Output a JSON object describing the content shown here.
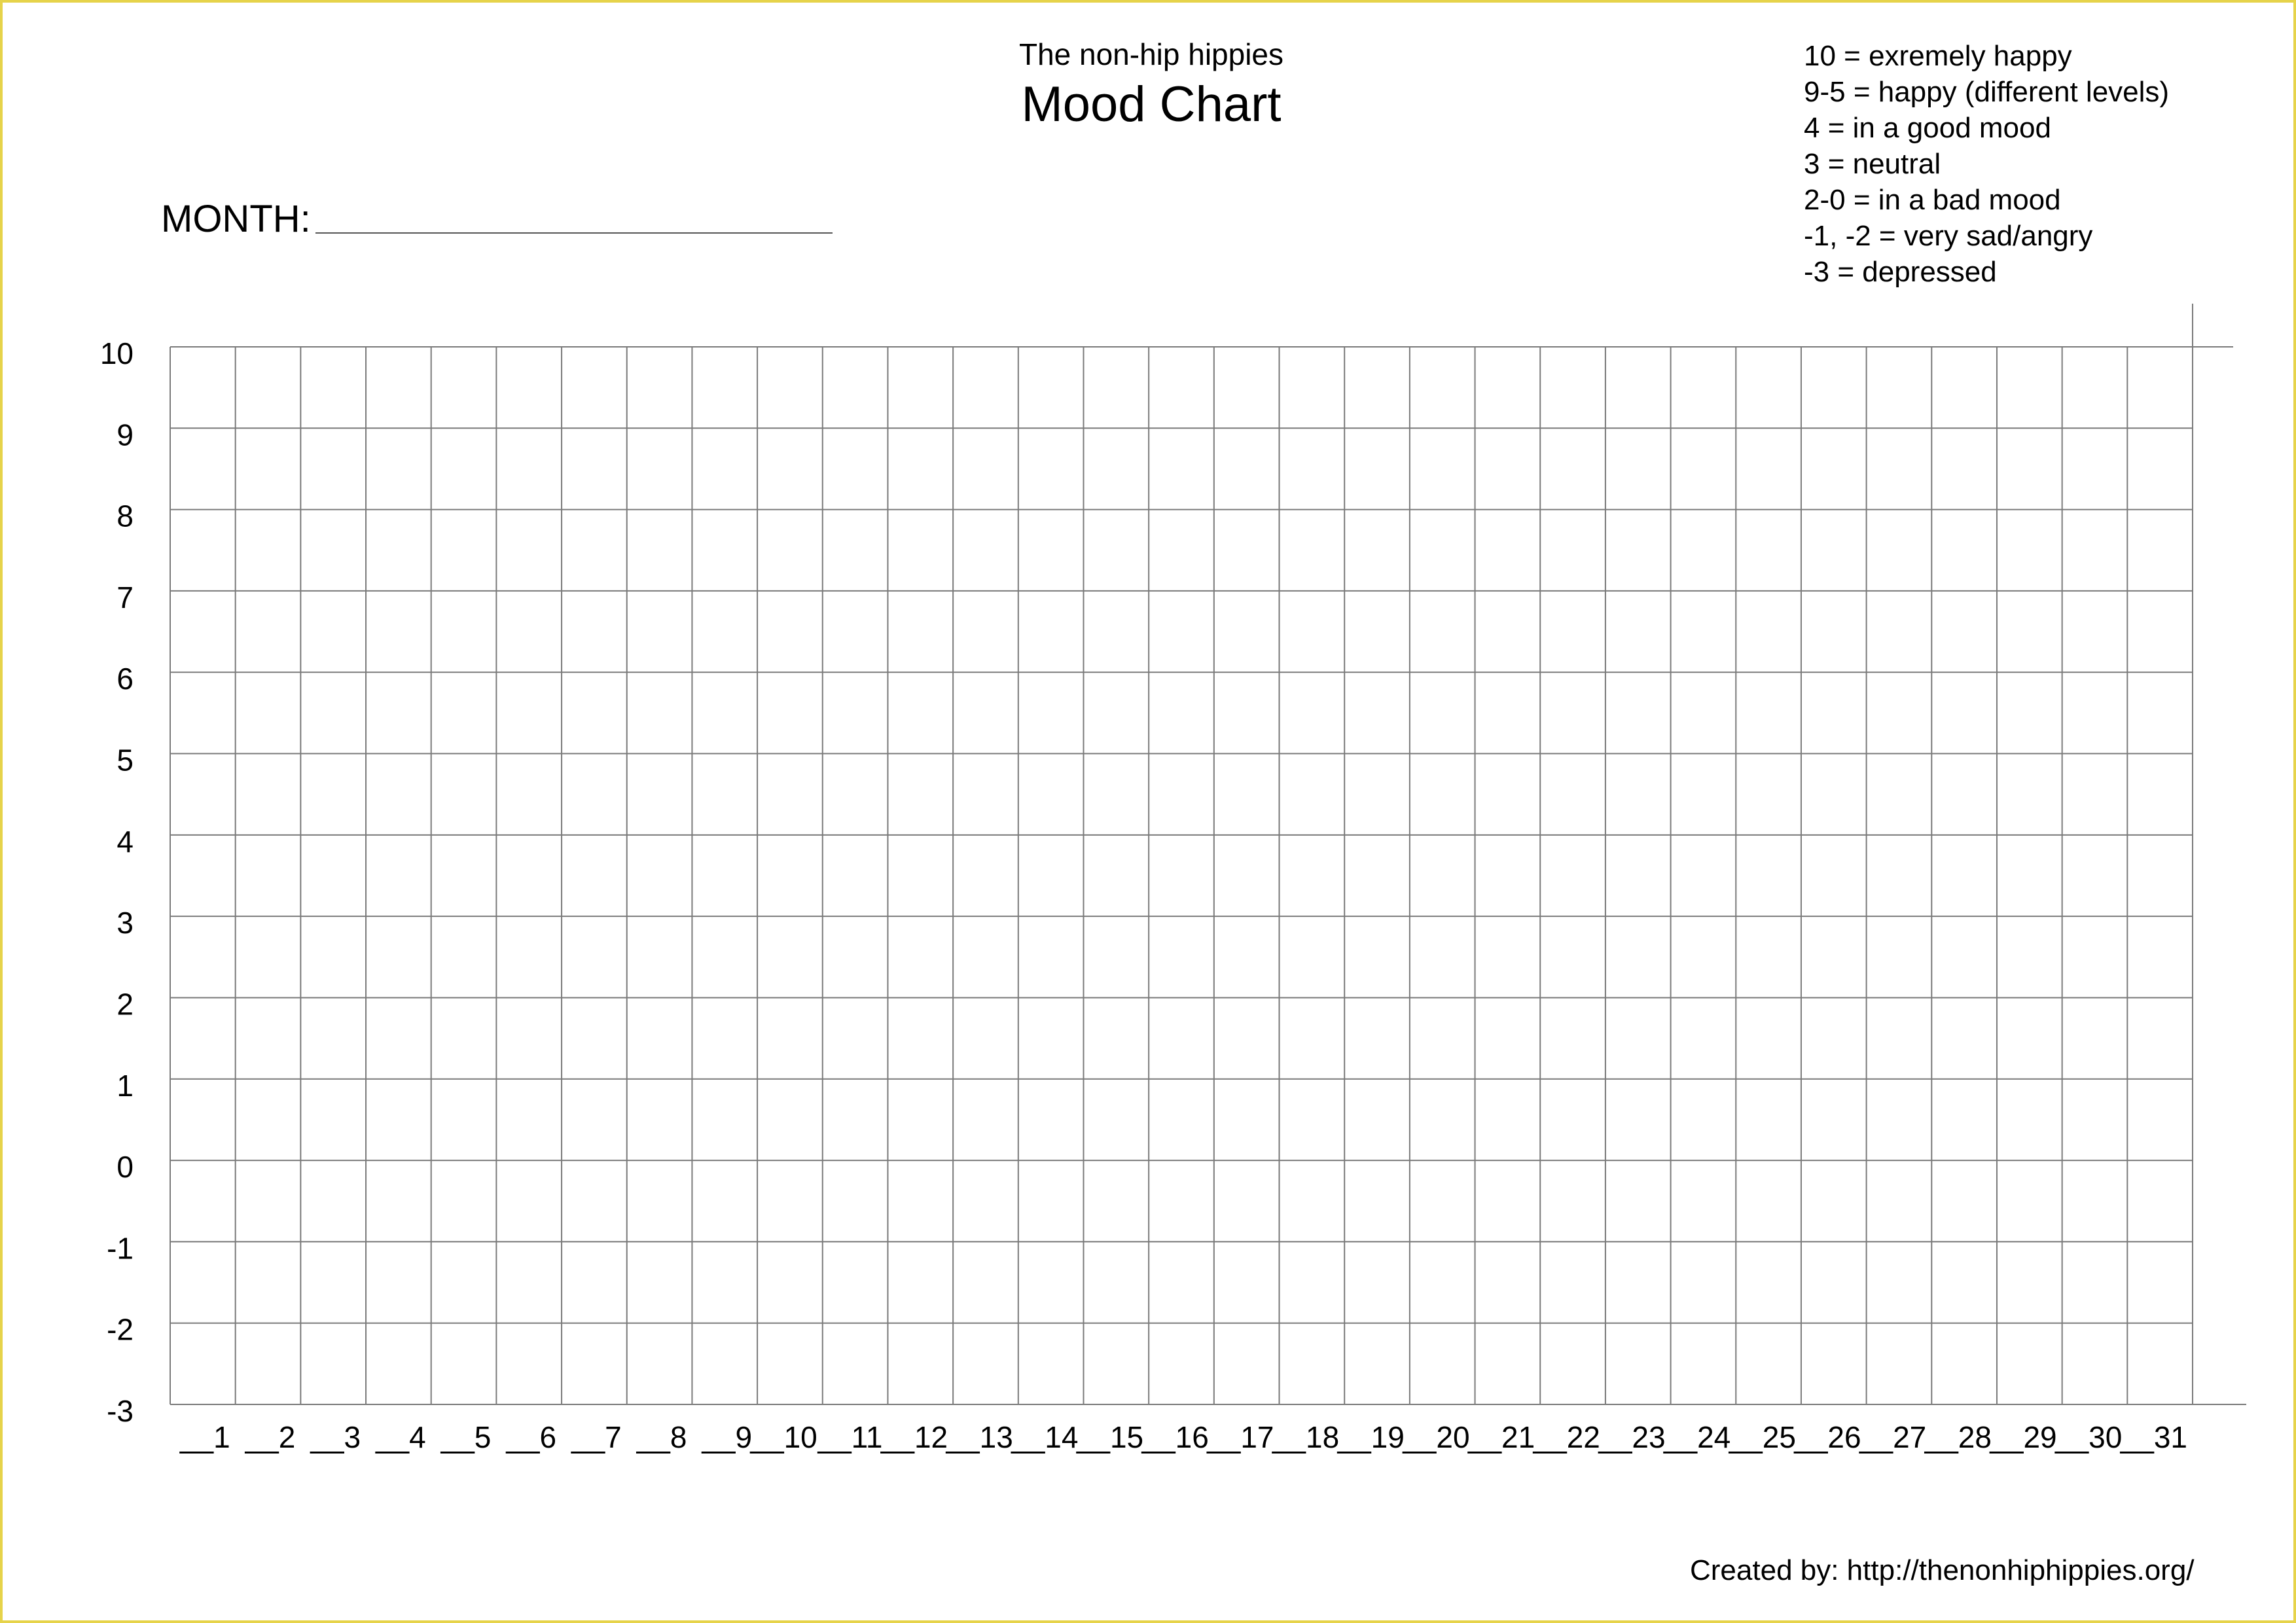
{
  "header": {
    "subtitle": "The non-hip hippies",
    "title": "Mood Chart"
  },
  "month_field": {
    "label": "MONTH:",
    "value": ""
  },
  "legend": [
    "10 = exremely happy",
    "9-5 = happy (different levels)",
    "4 = in a good mood",
    "3 = neutral",
    "2-0 = in a bad mood",
    "-1, -2 = very sad/angry",
    "-3 = depressed"
  ],
  "grid": {
    "y_ticks": [
      "10",
      "9",
      "8",
      "7",
      "6",
      "5",
      "4",
      "3",
      "2",
      "1",
      "0",
      "-1",
      "-2",
      "-3"
    ],
    "x_ticks": [
      "1",
      "2",
      "3",
      "4",
      "5",
      "6",
      "7",
      "8",
      "9",
      "10",
      "11",
      "12",
      "13",
      "14",
      "15",
      "16",
      "17",
      "18",
      "19",
      "20",
      "21",
      "22",
      "23",
      "24",
      "25",
      "26",
      "27",
      "28",
      "29",
      "30",
      "31"
    ],
    "x_tick_separator": "__",
    "line_color": "#7a7a7a",
    "border_color": "#e6d34a"
  },
  "footer": {
    "credit": "Created by: http://thenonhiphippies.org/"
  }
}
